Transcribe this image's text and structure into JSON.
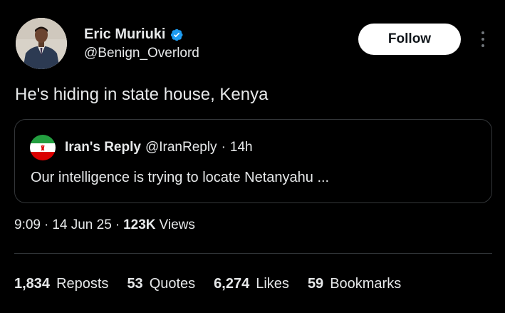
{
  "author": {
    "display_name": "Eric Muriuki",
    "handle": "@Benign_Overlord",
    "verified_icon": "verified-badge-icon",
    "verified_color": "#1d9bf0"
  },
  "actions": {
    "follow_label": "Follow",
    "more_icon": "more-vertical-icon"
  },
  "tweet": {
    "text": "He's hiding in state house, Kenya"
  },
  "quote": {
    "display_name": "Iran's Reply",
    "handle": "@IranReply",
    "separator": "·",
    "time": "14h",
    "text": "Our intelligence is trying to locate Netanyahu ...",
    "avatar_icon": "iran-flag-icon"
  },
  "meta": {
    "time": "9:09",
    "sep1": "·",
    "date": "14 Jun 25",
    "sep2": "·",
    "views_count": "123K",
    "views_label": "Views"
  },
  "stats": [
    {
      "count": "1,834",
      "label": "Reposts"
    },
    {
      "count": "53",
      "label": "Quotes"
    },
    {
      "count": "6,274",
      "label": "Likes"
    },
    {
      "count": "59",
      "label": "Bookmarks"
    }
  ],
  "colors": {
    "background": "#000000",
    "text": "#e7e9ea",
    "border": "#333639",
    "follow_bg": "#ffffff"
  }
}
